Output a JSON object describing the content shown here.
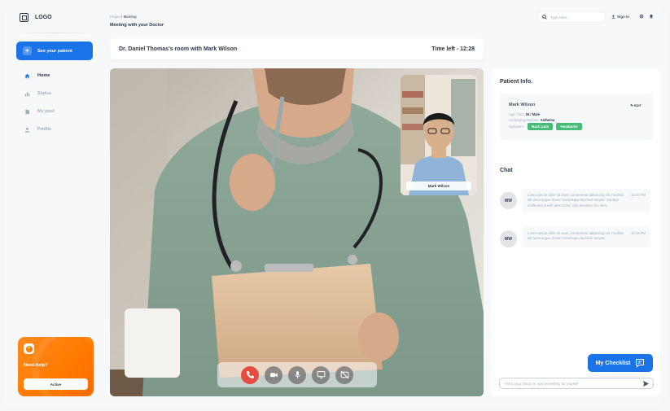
{
  "sidebar": {
    "logo": "LOGO",
    "primary_button": "See your patient",
    "items": [
      {
        "label": "Home",
        "icon": "home-icon",
        "active": true
      },
      {
        "label": "Status",
        "icon": "chart-icon",
        "active": false
      },
      {
        "label": "My post",
        "icon": "document-icon",
        "active": false
      },
      {
        "label": "Profile",
        "icon": "user-icon",
        "active": false
      }
    ],
    "help": {
      "title": "Need help?",
      "button": "Active",
      "icon": "question-icon"
    }
  },
  "header": {
    "breadcrumb_root": "Pages",
    "breadcrumb_sep": "/",
    "breadcrumb_current": "Meeting",
    "page_title": "Meeting with your Doctor",
    "search_placeholder": "Type here...",
    "signin": "Sign In",
    "icons": [
      "search-icon",
      "user-icon",
      "gear-icon",
      "bell-icon"
    ]
  },
  "room": {
    "title": "Dr. Daniel Thomas's room with Mark Wilson",
    "time_left": "Time left - 12:28"
  },
  "video": {
    "pip_name": "Mark Wilson",
    "controls": [
      "end-call-icon",
      "camera-icon",
      "microphone-icon",
      "screen-share-icon",
      "camera-off-icon"
    ]
  },
  "patient": {
    "section_title": "Patient Info.",
    "name": "Mark Wilson",
    "edit_label": "EDIT",
    "age_sex_label": "Age / Sex:",
    "age_sex_value": "26 / Male",
    "disease_label": "Underlying Disease:",
    "disease_value": "Asthema",
    "symptoms_label": "Symptom:",
    "symptoms": [
      "Back pain",
      "Headache"
    ]
  },
  "chat": {
    "section_title": "Chat",
    "messages": [
      {
        "initials": "MW",
        "text": "Lorem ipsum dolor sit amet, consectetur adipiscing elit. Facilisis elit amet augue donec scelerisque faucibus tempor. Volutpat mollis lectus velit amet tortor, odio tincidunt non sem.",
        "time": "15:46 PM"
      },
      {
        "initials": "MW",
        "text": "Lorem ipsum dolor sit amet, consectetur adipiscing elit. Facilisis elit amet augue donec scelerisque faucibus tempor.",
        "time": "15:48 PM"
      }
    ],
    "checklist_button": "My Checklist",
    "input_placeholder": "Ask to your doctor or note something for yourself"
  },
  "colors": {
    "accent": "#1a73e8",
    "help": "#ff7a00",
    "tag": "#48bb78",
    "end_call": "#e54d42"
  }
}
